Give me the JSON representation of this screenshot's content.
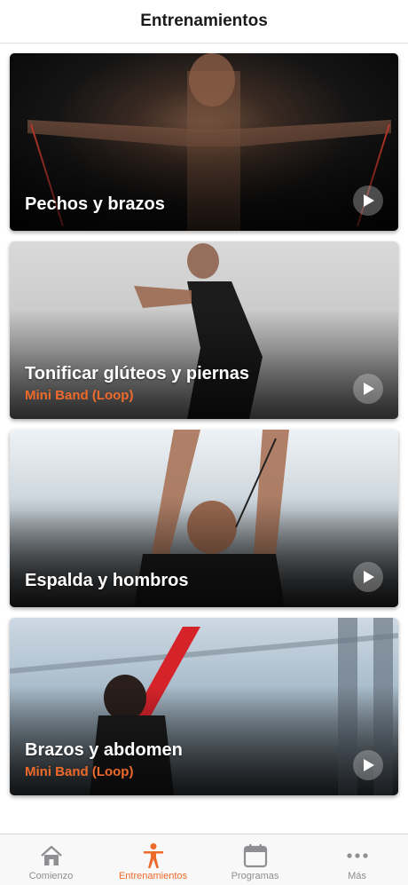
{
  "header": {
    "title": "Entrenamientos"
  },
  "colors": {
    "accent": "#ee6a2b",
    "inactive": "#8e8e93"
  },
  "workouts": [
    {
      "title": "Pechos y brazos",
      "subtitle": ""
    },
    {
      "title": "Tonificar glúteos y piernas",
      "subtitle": "Mini Band (Loop)"
    },
    {
      "title": "Espalda y hombros",
      "subtitle": ""
    },
    {
      "title": "Brazos y abdomen",
      "subtitle": "Mini Band (Loop)"
    }
  ],
  "tabs": [
    {
      "label": "Comienzo",
      "icon": "home-icon"
    },
    {
      "label": "Entrenamientos",
      "icon": "person-icon",
      "active": true
    },
    {
      "label": "Programas",
      "icon": "calendar-icon"
    },
    {
      "label": "Más",
      "icon": "more-icon"
    }
  ]
}
